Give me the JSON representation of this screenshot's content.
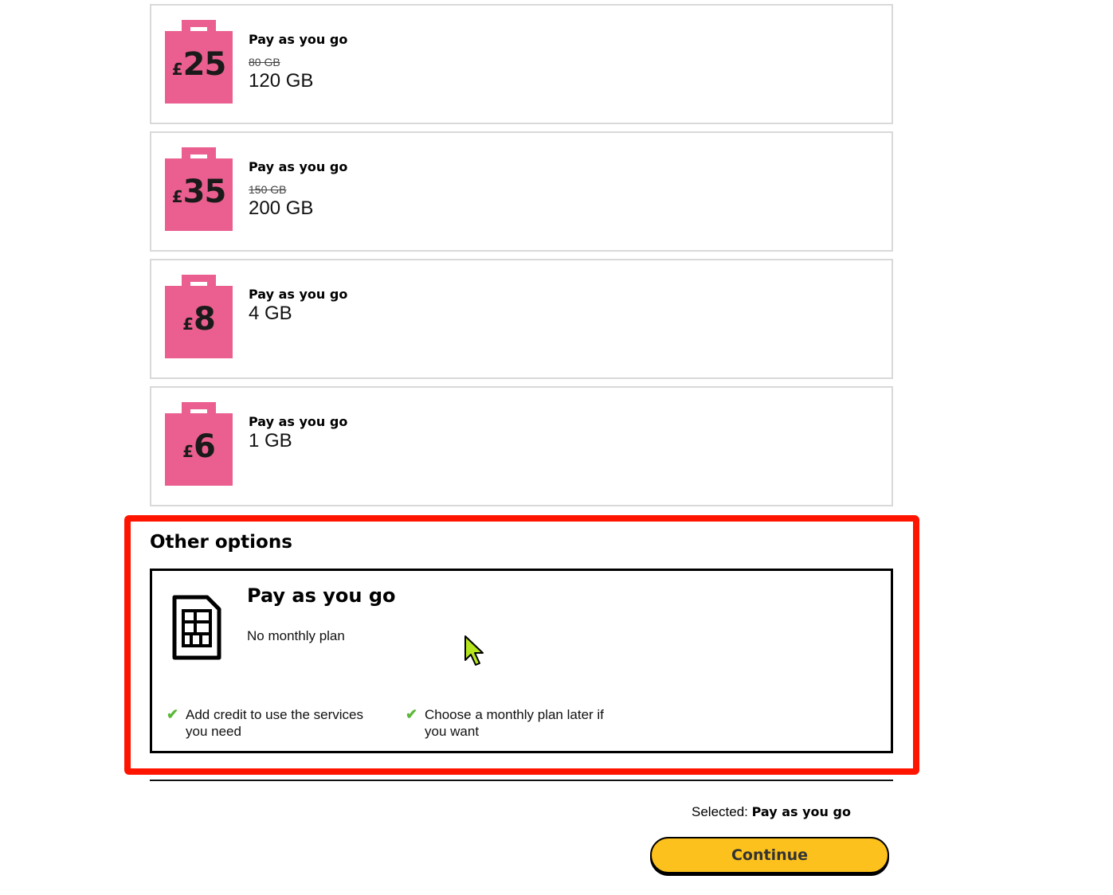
{
  "plans": [
    {
      "currency": "£",
      "price": "25",
      "title": "Pay as you go",
      "old_data": "80 GB",
      "data": "120 GB"
    },
    {
      "currency": "£",
      "price": "35",
      "title": "Pay as you go",
      "old_data": "150 GB",
      "data": "200 GB"
    },
    {
      "currency": "£",
      "price": "8",
      "title": "Pay as you go",
      "old_data": "",
      "data": "4 GB"
    },
    {
      "currency": "£",
      "price": "6",
      "title": "Pay as you go",
      "old_data": "",
      "data": "1 GB"
    }
  ],
  "other_options": {
    "heading": "Other options",
    "card": {
      "icon": "sim-card-icon",
      "title": "Pay as you go",
      "subtitle": "No monthly plan",
      "features": [
        "Add credit to use the services you need",
        "Choose a monthly plan later if you want"
      ]
    }
  },
  "footer": {
    "selected_label": "Selected:",
    "selected_value": "Pay as you go",
    "continue_label": "Continue"
  },
  "colors": {
    "bag_pink": "#ea5f8f",
    "highlight_red": "#ff1400",
    "button_yellow": "#fcc11c",
    "tick_green": "#5bb83a"
  }
}
